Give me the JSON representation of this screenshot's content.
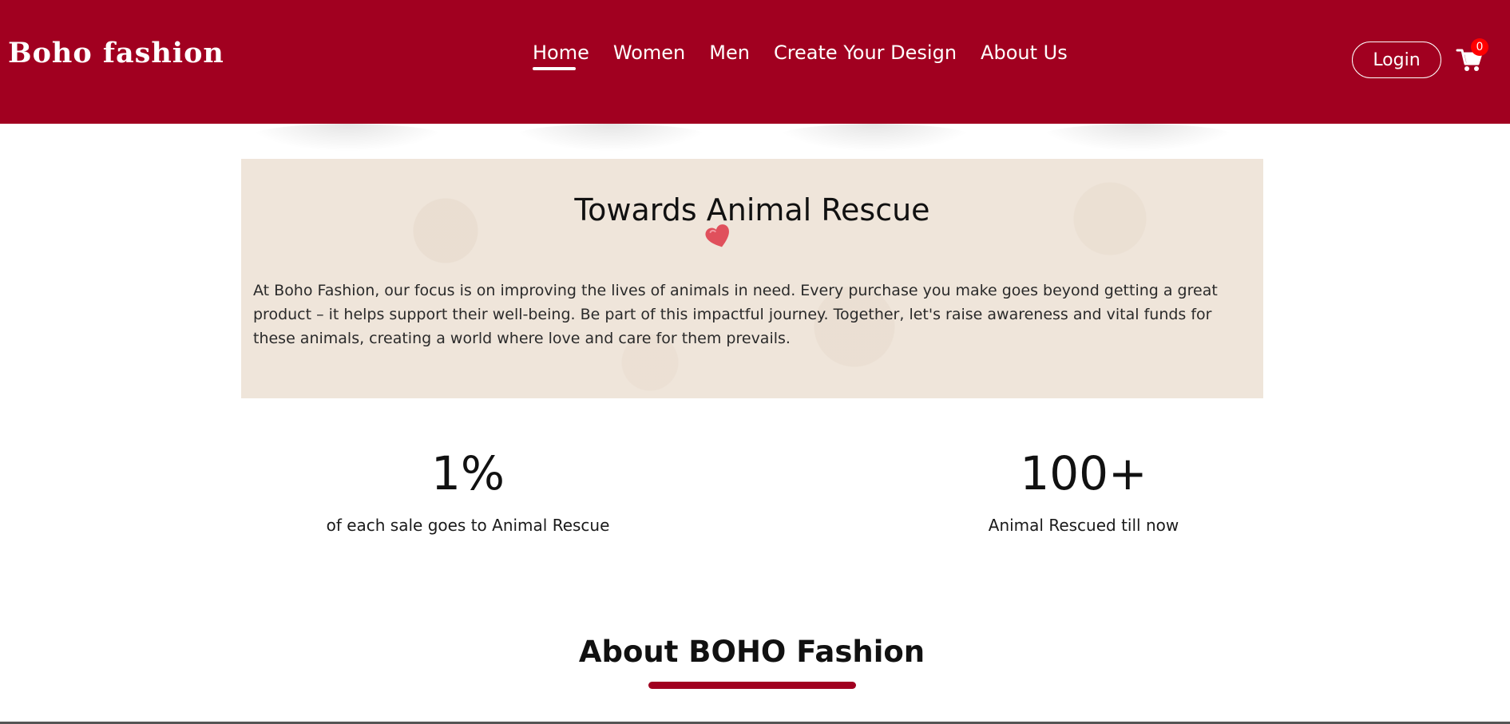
{
  "colors": {
    "header_background": "#a10020",
    "accent": "#a10020",
    "card_background": "#efe5da",
    "cart_badge": "#ff0000"
  },
  "header": {
    "brand": "Boho fashion",
    "nav": [
      {
        "label": "Home",
        "active": true
      },
      {
        "label": "Women",
        "active": false
      },
      {
        "label": "Men",
        "active": false
      },
      {
        "label": "Create Your Design",
        "active": false
      },
      {
        "label": "About Us",
        "active": false
      }
    ],
    "login_label": "Login",
    "cart_icon": "shopping-cart-icon",
    "cart_count": "0"
  },
  "rescue": {
    "title": "Towards Animal Rescue",
    "icon": "heart-icon",
    "text": "At Boho Fashion, our focus is on improving the lives of animals in need. Every purchase you make goes beyond getting a great product – it helps support their well-being. Be part of this impactful journey. Together, let's raise awareness and vital funds for these animals, creating a world where love and care for them prevails."
  },
  "stats": [
    {
      "value": "1%",
      "label": "of each sale goes to Animal Rescue"
    },
    {
      "value": "100+",
      "label": "Animal Rescued till now"
    }
  ],
  "about": {
    "title": "About BOHO Fashion"
  }
}
